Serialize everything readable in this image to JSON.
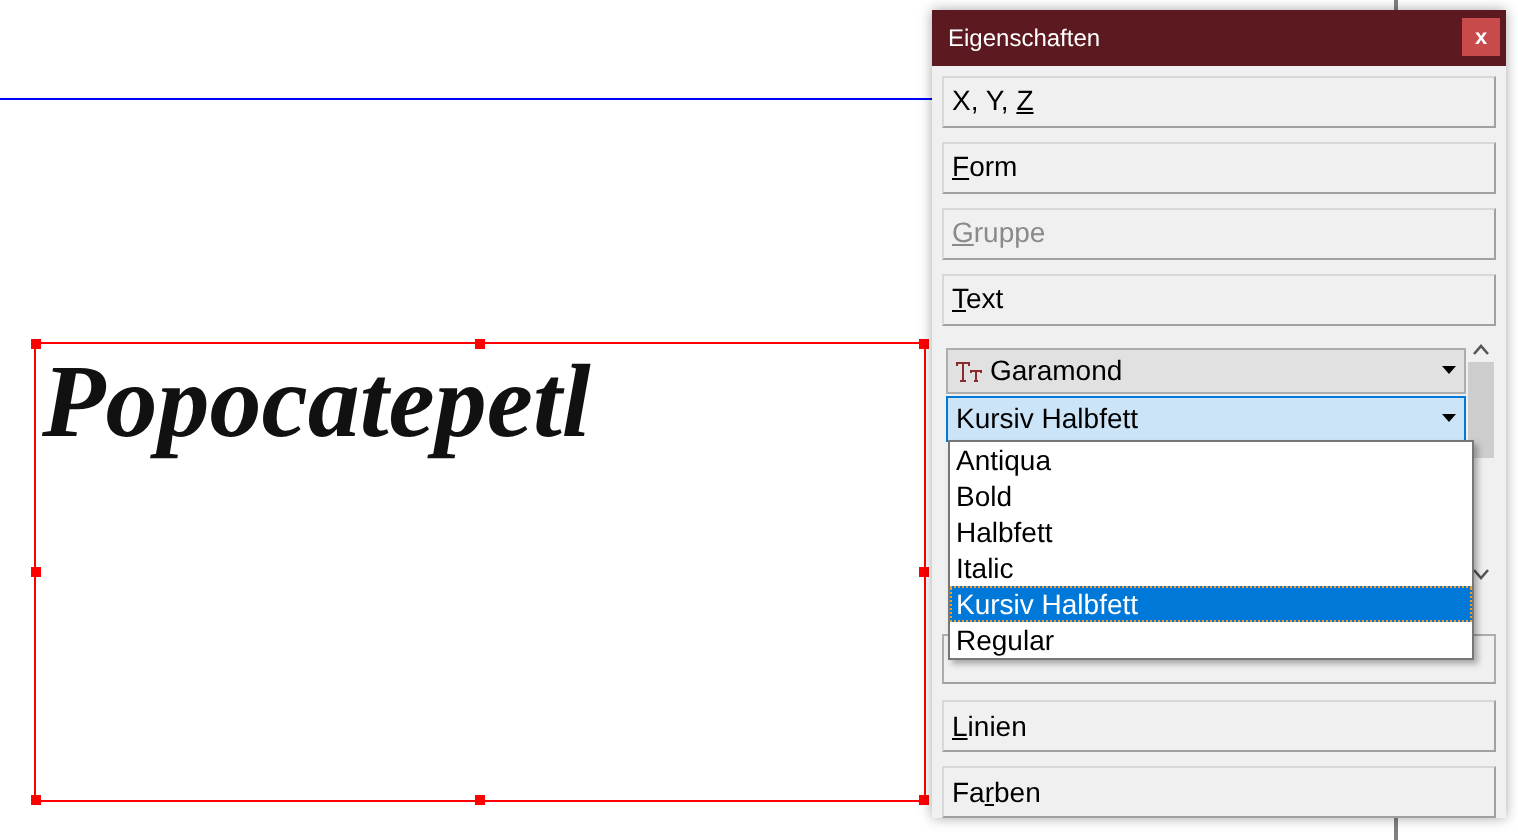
{
  "canvas": {
    "text": "Popocatepetl",
    "selected": true
  },
  "panel": {
    "title": "Eigenschaften",
    "close": "x",
    "sections_top": [
      {
        "before": "X, Y, ",
        "mnemonic": "Z",
        "disabled": false
      },
      {
        "mnemonic": "F",
        "after": "orm",
        "disabled": false
      },
      {
        "mnemonic": "G",
        "after": "ruppe",
        "disabled": true
      },
      {
        "mnemonic": "T",
        "after": "ext",
        "disabled": false
      }
    ],
    "font_family": "Garamond",
    "font_style": "Kursiv Halbfett",
    "style_options": [
      {
        "label": "Antiqua",
        "selected": false
      },
      {
        "label": "Bold",
        "selected": false
      },
      {
        "label": "Halbfett",
        "selected": false
      },
      {
        "label": "Italic",
        "selected": false
      },
      {
        "label": "Kursiv Halbfett",
        "selected": true
      },
      {
        "label": "Regular",
        "selected": false
      }
    ],
    "sections_bottom": [
      {
        "mnemonic": "L",
        "after": "inien",
        "disabled": false
      },
      {
        "before": "Fa",
        "mnemonic": "r",
        "after": "ben",
        "disabled": false
      }
    ]
  }
}
